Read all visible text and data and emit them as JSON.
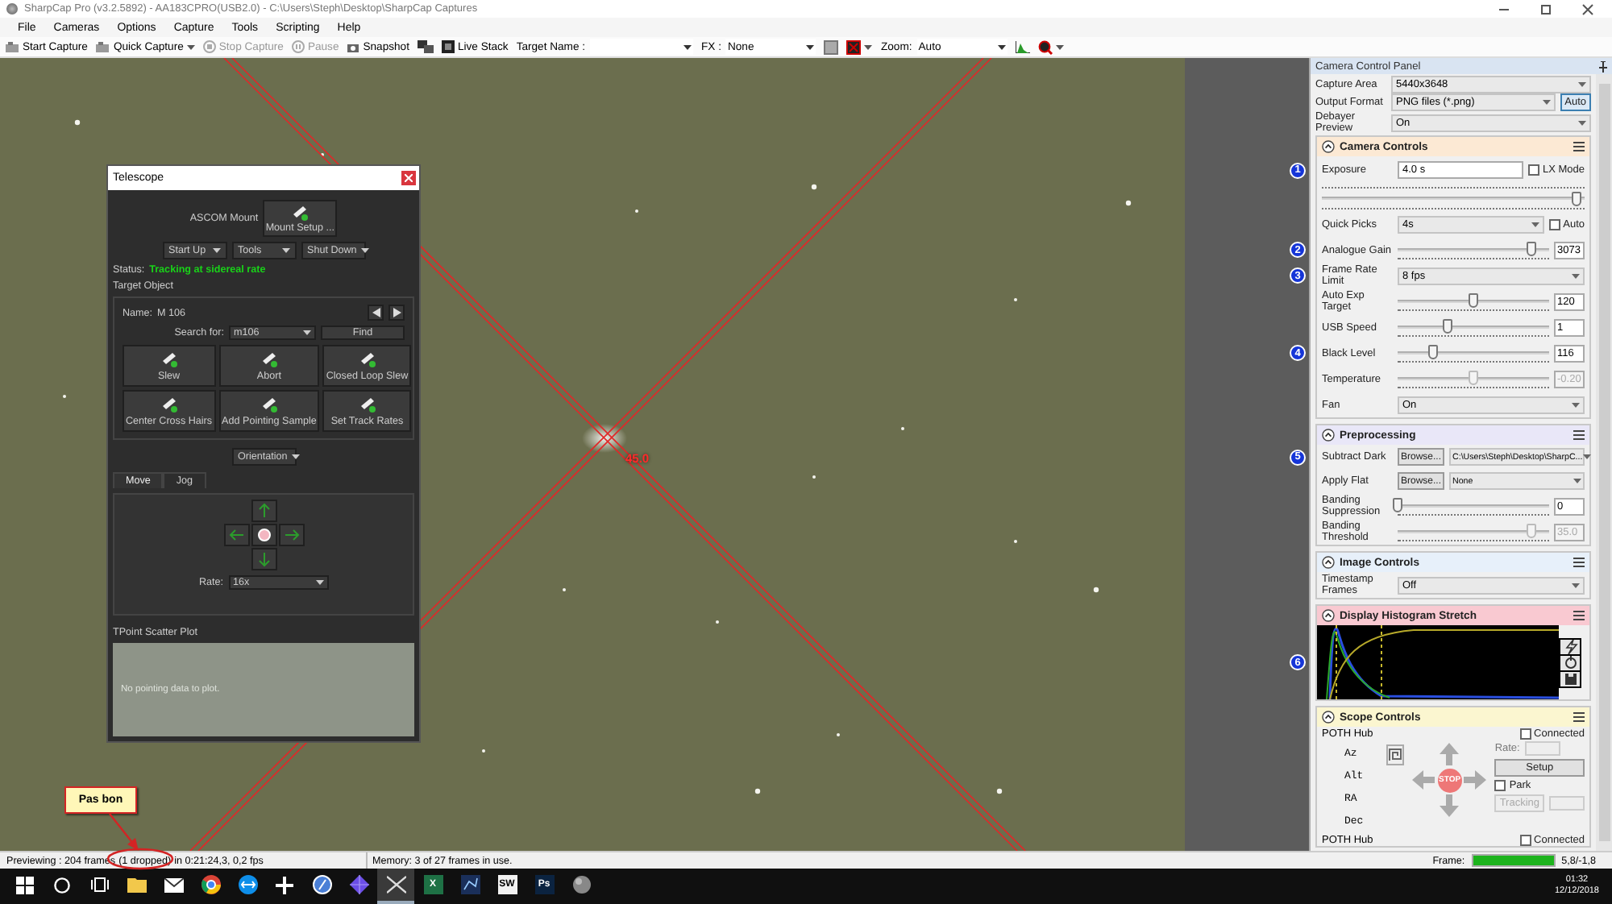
{
  "window": {
    "title": "SharpCap Pro (v3.2.5892) - AA183CPRO(USB2.0) - C:\\Users\\Steph\\Desktop\\SharpCap Captures"
  },
  "menu": [
    "File",
    "Cameras",
    "Options",
    "Capture",
    "Tools",
    "Scripting",
    "Help"
  ],
  "toolbar": [
    {
      "kind": "capture",
      "label": "Start Capture",
      "disabled": false
    },
    {
      "kind": "quick",
      "label": "Quick Capture",
      "disabled": false
    },
    {
      "kind": "stop",
      "label": "Stop Capture",
      "disabled": true
    },
    {
      "kind": "pause",
      "label": "Pause",
      "disabled": true
    },
    {
      "kind": "snapshot",
      "label": "Snapshot",
      "disabled": false
    },
    {
      "kind": "monitors"
    },
    {
      "kind": "stack",
      "label": "Live Stack",
      "disabled": false
    },
    {
      "kind": "namecombo",
      "label": "Target Name :"
    },
    {
      "kind": "combo",
      "label": "FX :",
      "value": "None"
    },
    {
      "kind": "square"
    },
    {
      "kind": "marker"
    },
    {
      "kind": "combo",
      "label": "Zoom:",
      "value": "Auto"
    },
    {
      "kind": "histogram"
    },
    {
      "kind": "zoomtool"
    }
  ],
  "viewer": {
    "overlay_label": "45.0"
  },
  "telescope": {
    "title": "Telescope",
    "mount_label": "ASCOM Mount",
    "mount_button": "Mount Setup ...",
    "menus": [
      "Start Up",
      "Tools",
      "Shut Down"
    ],
    "status_label": "Status:",
    "status": "Tracking at sidereal rate",
    "target_heading": "Target Object",
    "name_label": "Name:",
    "name": "M 106",
    "search_label": "Search for:",
    "search_value": "m106",
    "find": "Find",
    "actions": [
      "Slew",
      "Abort",
      "Closed Loop Slew",
      "Center Cross Hairs",
      "Add Pointing Sample",
      "Set Track Rates"
    ],
    "orientation": "Orientation",
    "tabs": [
      {
        "label": "Move",
        "selected": true
      },
      {
        "label": "Jog",
        "selected": false
      }
    ],
    "rate_label": "Rate:",
    "rate": "16x",
    "plot_title": "TPoint Scatter Plot",
    "plot_message": "No pointing data to plot."
  },
  "camera_panel": {
    "title": "Camera Control Panel",
    "top_rows": [
      {
        "kind": "combo",
        "label": "Capture Area",
        "value": "5440x3648"
      },
      {
        "kind": "combo",
        "label": "Output Format",
        "value": "PNG files (*.png)",
        "button": "Auto"
      },
      {
        "kind": "combo",
        "label": "Debayer Preview",
        "value": "On"
      }
    ],
    "sections": [
      {
        "title": "Camera Controls",
        "color": "#fce9d4",
        "rows": [
          {
            "kind": "text_check",
            "label": "Exposure",
            "value": "4.0 s",
            "check": "LX Mode",
            "checked": false,
            "badge": "1"
          },
          {
            "kind": "bare_slider",
            "level": 0.97
          },
          {
            "kind": "combo_check",
            "label": "Quick Picks",
            "value": "4s",
            "check": "Auto",
            "checked": false
          },
          {
            "kind": "slider",
            "label": "Analogue Gain",
            "level": 0.88,
            "value": "3073",
            "disabled": false,
            "badge": "2"
          },
          {
            "kind": "combo",
            "label": "Frame Rate Limit",
            "value": "8 fps",
            "badge": "3"
          },
          {
            "kind": "slider",
            "label": "Auto Exp Target",
            "level": 0.5,
            "value": "120",
            "disabled": false
          },
          {
            "kind": "slider",
            "label": "USB Speed",
            "level": 0.33,
            "value": "1",
            "disabled": false
          },
          {
            "kind": "slider",
            "label": "Black Level",
            "level": 0.23,
            "value": "116",
            "disabled": false,
            "badge": "4"
          },
          {
            "kind": "slider",
            "label": "Temperature",
            "level": 0.5,
            "value": "-0.20",
            "disabled": true
          },
          {
            "kind": "combo",
            "label": "Fan",
            "value": "On"
          }
        ]
      },
      {
        "title": "Preprocessing",
        "color": "#e9e7f8",
        "rows": [
          {
            "kind": "browse",
            "label": "Subtract Dark",
            "button": "Browse...",
            "value": "C:\\Users\\Steph\\Desktop\\SharpC...",
            "badge": "5"
          },
          {
            "kind": "browse",
            "label": "Apply Flat",
            "button": "Browse...",
            "value": "None"
          },
          {
            "kind": "slider",
            "label": "Banding Suppression",
            "level": 0,
            "value": "0",
            "disabled": false
          },
          {
            "kind": "slider",
            "label": "Banding Threshold",
            "level": 0.88,
            "value": "35.0",
            "disabled": true
          }
        ]
      },
      {
        "title": "Image Controls",
        "color": "#e7f0fa",
        "rows": [
          {
            "kind": "combo",
            "label": "Timestamp Frames",
            "value": "Off"
          }
        ]
      },
      {
        "title": "Display Histogram Stretch",
        "color": "#f9c9d1",
        "rows": [
          {
            "kind": "histogram",
            "badge": "6"
          }
        ]
      },
      {
        "title": "Scope Controls",
        "color": "#fbf6d0",
        "rows": [
          {
            "kind": "scope",
            "device": "POTH Hub",
            "check": "Connected",
            "checked": false,
            "axes": [
              "Az",
              "Alt",
              "RA",
              "Dec"
            ],
            "rate_label": "Rate:",
            "stop": "STOP",
            "setup": "Setup",
            "park": "Park",
            "park_checked": false,
            "tracking": "Tracking"
          },
          {
            "kind": "device",
            "device": "POTH Hub",
            "check": "Connected",
            "checked": false
          }
        ]
      }
    ]
  },
  "callout": {
    "text": "Pas bon"
  },
  "status_bar": {
    "preview": "Previewing : 204 frames",
    "dropped": "(1 dropped)",
    "timing": "in 0:21:24,3, 0,2 fps",
    "memory": "Memory: 3 of 27 frames in use.",
    "frame": {
      "label": "Frame:",
      "level": 1,
      "reading": "5,8/-1,8"
    }
  },
  "taskbar": {
    "apps": [
      {
        "kind": "start",
        "selected": false
      },
      {
        "kind": "search",
        "selected": false
      },
      {
        "kind": "taskview",
        "selected": false
      },
      {
        "kind": "folder",
        "selected": false
      },
      {
        "kind": "mail",
        "selected": false
      },
      {
        "kind": "browser",
        "selected": false
      },
      {
        "kind": "remote",
        "selected": false
      },
      {
        "kind": "plus",
        "selected": false
      },
      {
        "kind": "compass",
        "selected": false
      },
      {
        "kind": "gem",
        "selected": false
      },
      {
        "kind": "crossed",
        "selected": true
      },
      {
        "kind": "tile",
        "label": "X",
        "color": "#1e7145",
        "selected": false
      },
      {
        "kind": "constellation",
        "selected": false
      },
      {
        "kind": "tile",
        "label": "SW",
        "color": "#f2f2f2",
        "selected": false
      },
      {
        "kind": "tile",
        "label": "Ps",
        "color": "#0b2340",
        "selected": false
      },
      {
        "kind": "disc",
        "selected": false
      }
    ],
    "time": "01:32",
    "date": "12/12/2018"
  }
}
